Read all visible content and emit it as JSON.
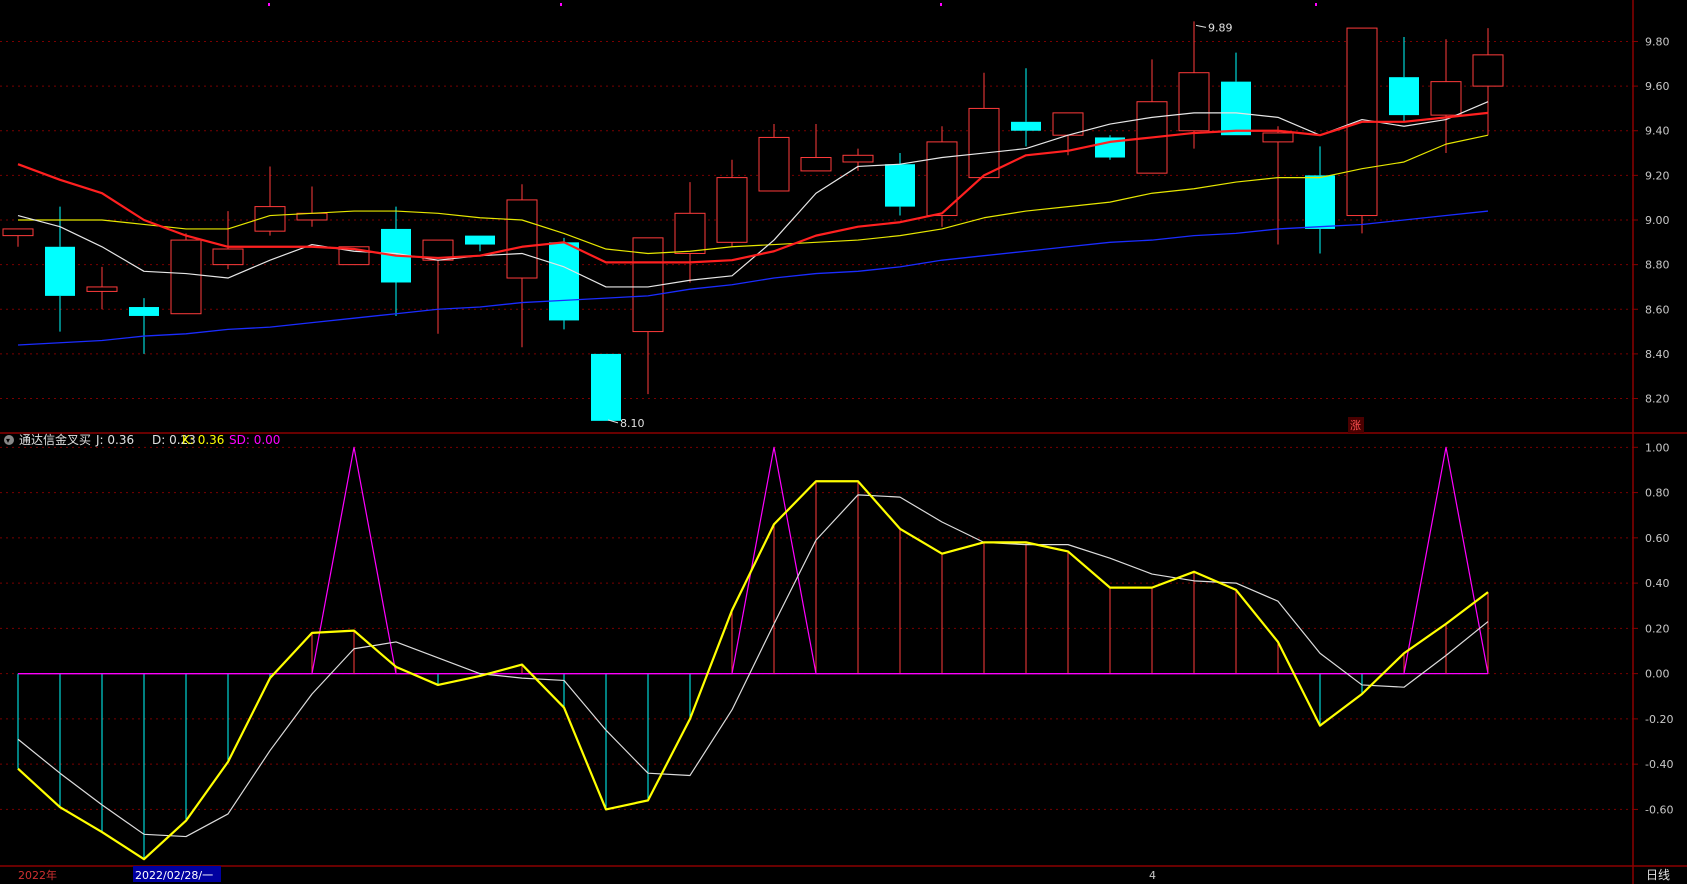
{
  "colors": {
    "background": "#000000",
    "frame": "#8b0000",
    "grid": "#7a0000",
    "up": "#ff3b3b",
    "down": "#00ffff",
    "ma_white": "#e6e6e6",
    "ma_red": "#ff2020",
    "ma_yellow": "#e6e600",
    "ma_blue": "#1a2cff",
    "j_line": "#ffff00",
    "d_line": "#dcdcdc",
    "sd_line": "#ff00ff"
  },
  "chart_data": [
    {
      "type": "candlestick",
      "name": "price",
      "ylim": [
        8.05,
        9.95
      ],
      "yticks": [
        8.2,
        8.4,
        8.6,
        8.8,
        9.0,
        9.2,
        9.4,
        9.6,
        9.8
      ],
      "ohlc": [
        [
          8.93,
          8.96,
          8.88,
          8.96
        ],
        [
          8.88,
          9.06,
          8.5,
          8.66
        ],
        [
          8.68,
          8.79,
          8.6,
          8.7
        ],
        [
          8.61,
          8.65,
          8.4,
          8.57
        ],
        [
          8.58,
          8.94,
          8.58,
          8.91
        ],
        [
          8.8,
          9.04,
          8.78,
          8.87
        ],
        [
          8.95,
          9.24,
          8.93,
          9.06
        ],
        [
          9.0,
          9.15,
          8.97,
          9.03
        ],
        [
          8.8,
          8.88,
          8.8,
          8.88
        ],
        [
          8.96,
          9.06,
          8.57,
          8.72
        ],
        [
          8.82,
          8.91,
          8.49,
          8.91
        ],
        [
          8.93,
          8.93,
          8.86,
          8.89
        ],
        [
          8.74,
          9.16,
          8.43,
          9.09
        ],
        [
          8.9,
          8.92,
          8.51,
          8.55
        ],
        [
          8.4,
          8.4,
          8.1,
          8.1
        ],
        [
          8.5,
          8.92,
          8.22,
          8.92
        ],
        [
          8.85,
          9.17,
          8.72,
          9.03
        ],
        [
          8.9,
          9.27,
          8.88,
          9.19
        ],
        [
          9.13,
          9.43,
          9.13,
          9.37
        ],
        [
          9.22,
          9.43,
          9.22,
          9.28
        ],
        [
          9.26,
          9.32,
          9.22,
          9.29
        ],
        [
          9.25,
          9.3,
          9.02,
          9.06
        ],
        [
          9.02,
          9.42,
          8.97,
          9.35
        ],
        [
          9.19,
          9.66,
          9.19,
          9.5
        ],
        [
          9.44,
          9.68,
          9.33,
          9.4
        ],
        [
          9.38,
          9.48,
          9.29,
          9.48
        ],
        [
          9.37,
          9.38,
          9.27,
          9.28
        ],
        [
          9.21,
          9.72,
          9.21,
          9.53
        ],
        [
          9.4,
          9.89,
          9.32,
          9.66
        ],
        [
          9.62,
          9.75,
          9.38,
          9.38
        ],
        [
          9.35,
          9.42,
          8.89,
          9.39
        ],
        [
          9.2,
          9.33,
          8.85,
          8.96
        ],
        [
          9.02,
          9.86,
          8.94,
          9.86
        ],
        [
          9.64,
          9.82,
          9.44,
          9.47
        ],
        [
          9.47,
          9.81,
          9.3,
          9.62
        ],
        [
          9.6,
          9.86,
          9.38,
          9.74
        ]
      ],
      "ma_white": [
        9.02,
        8.97,
        8.88,
        8.77,
        8.76,
        8.74,
        8.82,
        8.89,
        8.86,
        8.85,
        8.82,
        8.84,
        8.85,
        8.79,
        8.7,
        8.7,
        8.73,
        8.75,
        8.91,
        9.12,
        9.24,
        9.25,
        9.28,
        9.3,
        9.32,
        9.38,
        9.43,
        9.46,
        9.48,
        9.48,
        9.46,
        9.38,
        9.45,
        9.42,
        9.45,
        9.53
      ],
      "ma_red": [
        9.25,
        9.18,
        9.12,
        9.0,
        8.93,
        8.88,
        8.88,
        8.88,
        8.87,
        8.84,
        8.83,
        8.84,
        8.88,
        8.9,
        8.81,
        8.81,
        8.81,
        8.82,
        8.86,
        8.93,
        8.97,
        8.99,
        9.03,
        9.2,
        9.29,
        9.31,
        9.35,
        9.37,
        9.39,
        9.4,
        9.4,
        9.38,
        9.44,
        9.44,
        9.46,
        9.48
      ],
      "ma_yellow": [
        9.0,
        9.0,
        9.0,
        8.98,
        8.96,
        8.96,
        9.02,
        9.03,
        9.04,
        9.04,
        9.03,
        9.01,
        9.0,
        8.94,
        8.87,
        8.85,
        8.86,
        8.88,
        8.89,
        8.9,
        8.91,
        8.93,
        8.96,
        9.01,
        9.04,
        9.06,
        9.08,
        9.12,
        9.14,
        9.17,
        9.19,
        9.19,
        9.23,
        9.26,
        9.34,
        9.38
      ],
      "ma_blue": [
        8.44,
        8.45,
        8.46,
        8.48,
        8.49,
        8.51,
        8.52,
        8.54,
        8.56,
        8.58,
        8.6,
        8.61,
        8.63,
        8.64,
        8.65,
        8.66,
        8.69,
        8.71,
        8.74,
        8.76,
        8.77,
        8.79,
        8.82,
        8.84,
        8.86,
        8.88,
        8.9,
        8.91,
        8.93,
        8.94,
        8.96,
        8.97,
        8.98,
        9.0,
        9.02,
        9.04
      ],
      "high_label": "9.89",
      "low_label": "8.10"
    },
    {
      "type": "line",
      "name": "通达信金叉买",
      "ylim": [
        -0.85,
        1.05
      ],
      "yticks": [
        -0.6,
        -0.4,
        -0.2,
        0.0,
        0.2,
        0.4,
        0.6,
        0.8,
        1.0
      ],
      "series": [
        {
          "name": "J",
          "values": [
            -0.42,
            -0.59,
            -0.7,
            -0.82,
            -0.65,
            -0.39,
            -0.02,
            0.18,
            0.19,
            0.03,
            -0.05,
            -0.01,
            0.04,
            -0.15,
            -0.6,
            -0.56,
            -0.2,
            0.28,
            0.66,
            0.85,
            0.85,
            0.64,
            0.53,
            0.58,
            0.58,
            0.54,
            0.38,
            0.38,
            0.45,
            0.37,
            0.14,
            -0.23,
            -0.09,
            0.09,
            0.22,
            0.36
          ]
        },
        {
          "name": "D",
          "values": [
            -0.29,
            -0.44,
            -0.58,
            -0.71,
            -0.72,
            -0.62,
            -0.34,
            -0.09,
            0.11,
            0.14,
            0.07,
            0.0,
            -0.02,
            -0.03,
            -0.25,
            -0.44,
            -0.45,
            -0.16,
            0.22,
            0.59,
            0.79,
            0.78,
            0.67,
            0.58,
            0.57,
            0.57,
            0.51,
            0.44,
            0.41,
            0.4,
            0.32,
            0.09,
            -0.05,
            -0.06,
            0.08,
            0.23
          ]
        },
        {
          "name": "SD",
          "values": [
            0,
            0,
            0,
            0,
            0,
            0,
            0,
            0,
            1.0,
            0,
            0,
            0,
            0,
            0,
            0,
            0,
            0,
            0,
            1.0,
            0,
            0,
            0,
            0,
            0,
            0,
            0,
            0,
            0,
            0,
            0,
            0,
            0,
            0,
            0,
            1.0,
            0
          ]
        }
      ],
      "legend": {
        "indicator": "通达信金叉买",
        "j": "J: 0.36",
        "d": "D: 0.23",
        "k": "K: 0.36",
        "sd": "SD: 0.00"
      }
    }
  ],
  "bottom_axis": {
    "year": "2022年",
    "cursor_date": "2022/02/28/一",
    "month_mark": "4",
    "period": "日线"
  },
  "badge": "涨"
}
